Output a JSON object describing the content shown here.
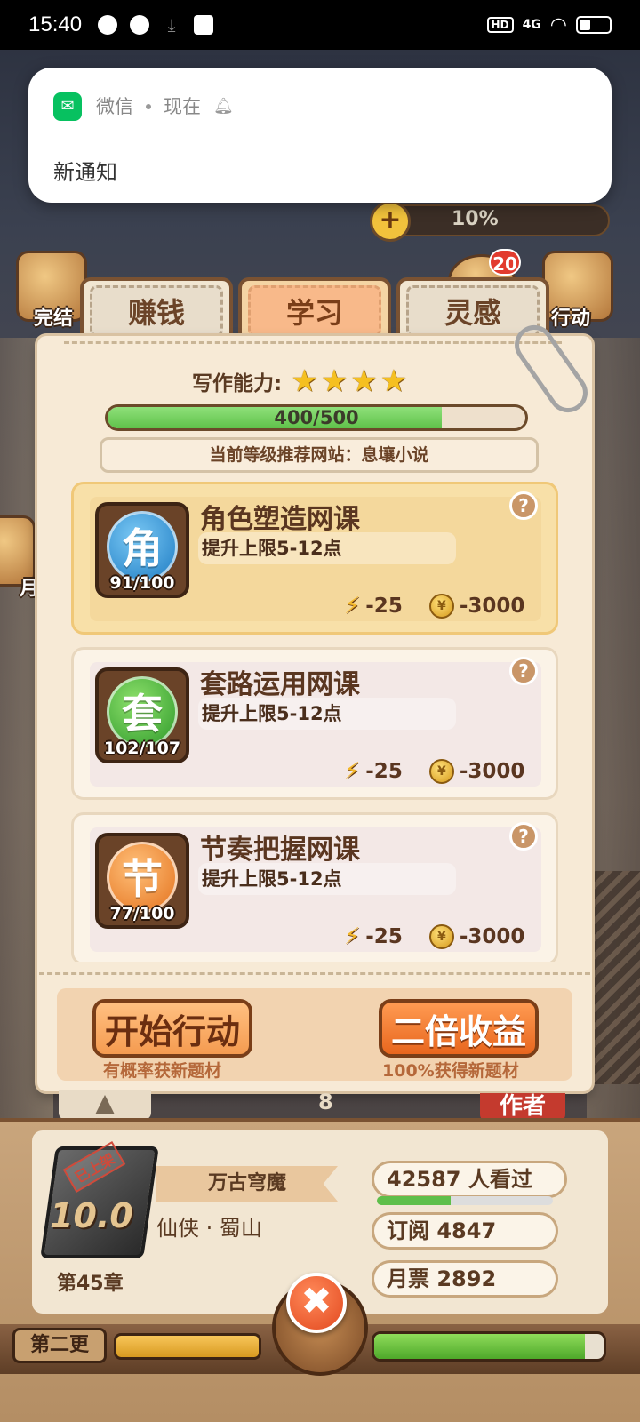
{
  "status_bar": {
    "time": "15:40",
    "hd": "HD",
    "signal": "4G",
    "icons": [
      "wechat-icon",
      "speed-icon",
      "download-icon",
      "inbox-icon",
      "wifi-icon",
      "battery-icon"
    ]
  },
  "notification": {
    "app": "微信",
    "time": "现在",
    "body": "新通知"
  },
  "background": {
    "energy_percent": "10%",
    "badge_count": "20",
    "left_label_1": "完结",
    "left_label_2": "月",
    "right_label": "行动"
  },
  "tabs": [
    {
      "label": "赚钱",
      "active": false
    },
    {
      "label": "学习",
      "active": true
    },
    {
      "label": "灵感",
      "active": false
    }
  ],
  "panel": {
    "ability_label": "写作能力:",
    "stars": 4,
    "progress_text": "400/500",
    "progress_fraction": 0.8,
    "recommend_text": "当前等级推荐网站：息壤小说"
  },
  "courses": [
    {
      "icon_char": "角",
      "count": "91/100",
      "title": "角色塑造网课",
      "subtitle": "提升上限5-12点",
      "energy_cost": "-25",
      "coin_cost": "-3000",
      "color": "blue",
      "selected": true
    },
    {
      "icon_char": "套",
      "count": "102/107",
      "title": "套路运用网课",
      "subtitle": "提升上限5-12点",
      "energy_cost": "-25",
      "coin_cost": "-3000",
      "color": "green",
      "selected": false
    },
    {
      "icon_char": "节",
      "count": "77/100",
      "title": "节奏把握网课",
      "subtitle": "提升上限5-12点",
      "energy_cost": "-25",
      "coin_cost": "-3000",
      "color": "orange",
      "selected": false
    }
  ],
  "actions": {
    "start_label": "开始行动",
    "start_sub": "有概率获新题材",
    "double_label": "二倍收益",
    "double_sub": "100%获得新题材"
  },
  "under": {
    "number": "8",
    "red_label": "作者"
  },
  "book": {
    "stamp": "已上架",
    "score": "10.0",
    "chapter": "第45章",
    "title": "万古穹魔",
    "genre": "仙侠 · 蜀山",
    "views": "42587   人看过",
    "views_fraction": 0.42,
    "subscribe": "订阅  4847",
    "monthly": "月票  2892"
  },
  "bottom": {
    "second_label": "第二更",
    "green_fraction": 0.92,
    "close_symbol": "✖"
  },
  "colors": {
    "accent_orange": "#f59b50",
    "panel_bg": "#f7ead6",
    "wechat_green": "#07c160"
  }
}
